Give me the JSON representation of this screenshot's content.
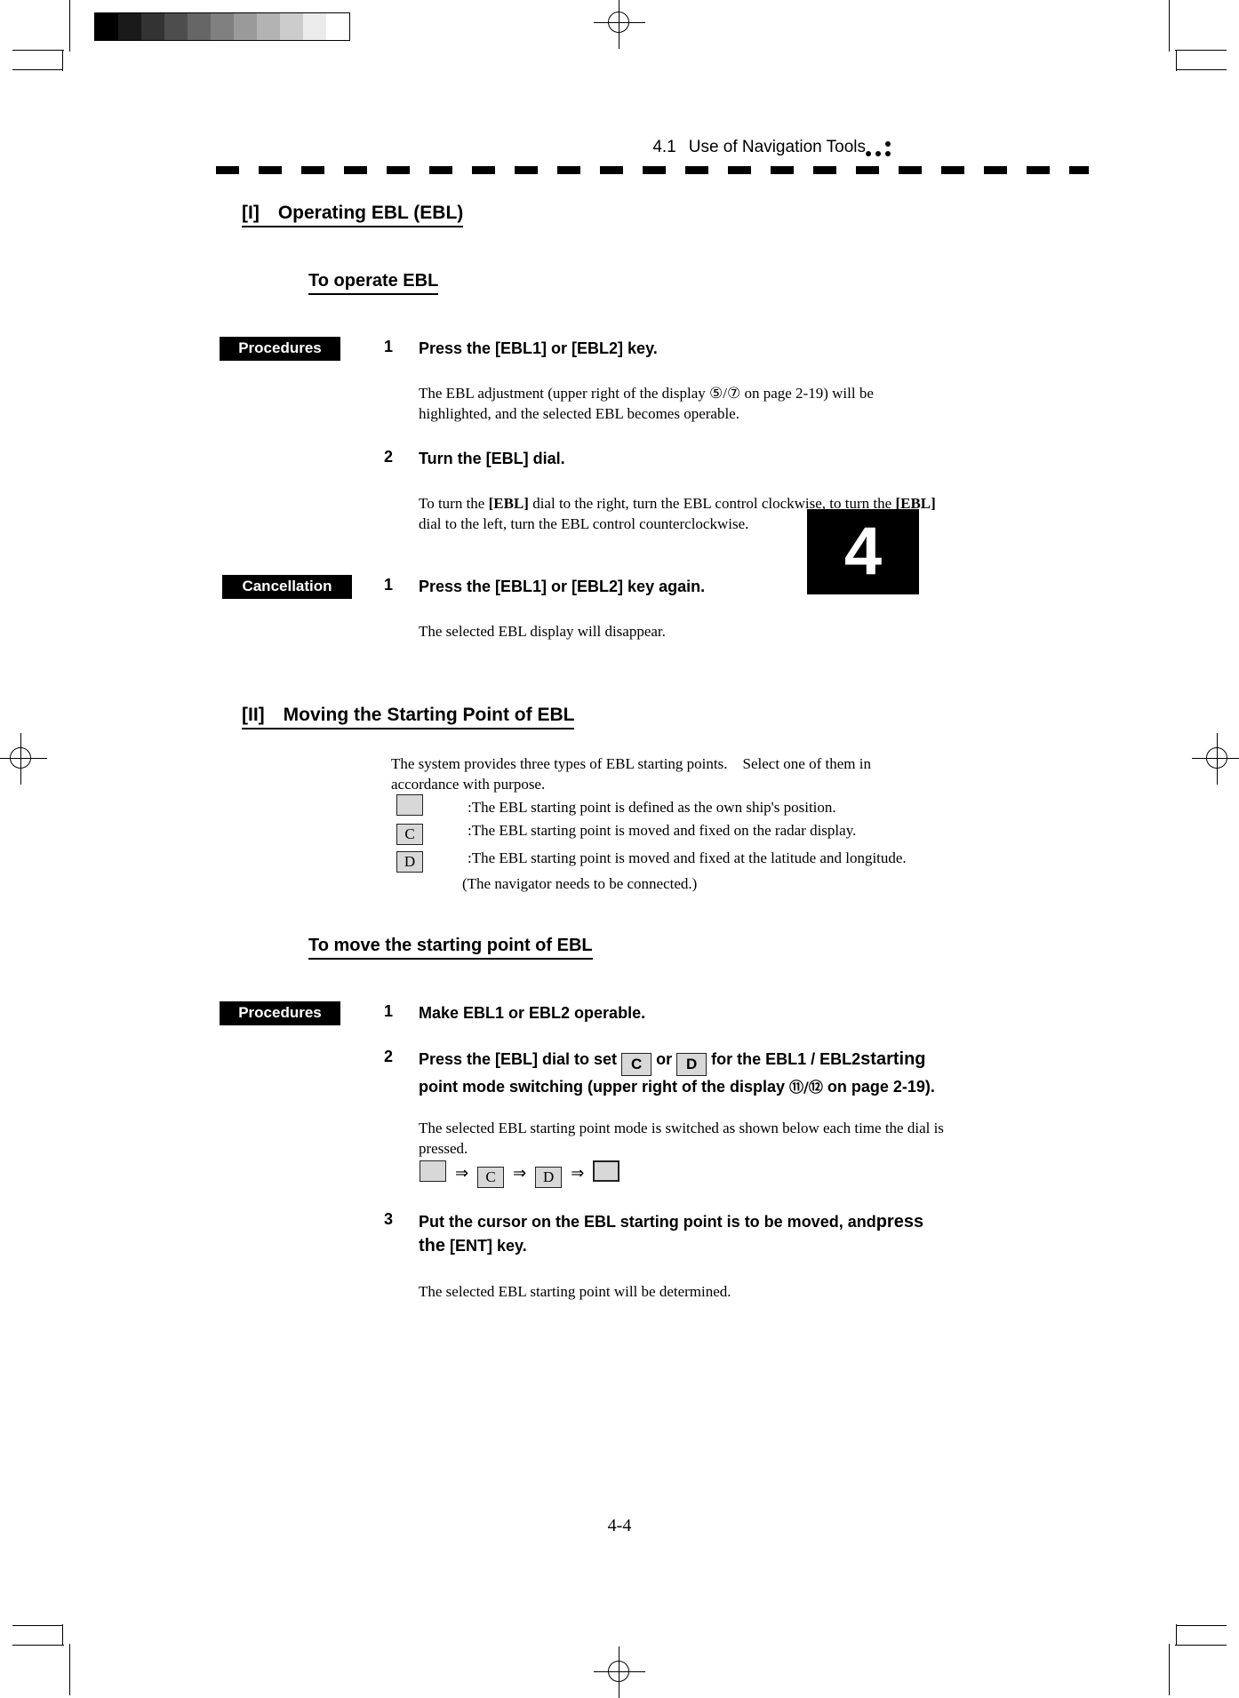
{
  "header": {
    "section_number": "4.1",
    "section_title": "Use of Navigation Tools"
  },
  "chapter_tab": "4",
  "footer": {
    "page_number": "4-4"
  },
  "sections": [
    {
      "heading": "[I] Operating EBL (EBL)",
      "subheading": "To operate EBL",
      "blocks": [
        {
          "tag": "Procedures",
          "steps": [
            {
              "number": "1",
              "title": "Press the [EBL1] or [EBL2] key.",
              "body_lines": [
                "The EBL adjustment (upper right of the display  ⑤/⑦  on page 2-19) will be",
                "highlighted, and the selected EBL becomes operable."
              ]
            },
            {
              "number": "2",
              "title": "Turn the [EBL] dial.",
              "body_lines": [
                "To turn the [EBL] dial to the right, turn the EBL control clockwise, to turn the [EBL]",
                "dial to the left, turn the EBL control counterclockwise."
              ]
            }
          ]
        },
        {
          "tag": "Cancellation",
          "steps": [
            {
              "number": "1",
              "title": "Press the [EBL1] or [EBL2] key again.",
              "body_lines": [
                "The selected EBL display will disappear."
              ]
            }
          ]
        }
      ]
    },
    {
      "heading": "[II] Moving the Starting Point of EBL",
      "subheading": "To move the starting point of EBL",
      "intro_lines": [
        "The system provides three types of EBL starting points. Select one of them in",
        "accordance with purpose."
      ],
      "legend": [
        {
          "key": "",
          "text": ":The EBL starting point is defined as the own ship's position."
        },
        {
          "key": "C",
          "text": ":The EBL starting point is moved and fixed on the radar display."
        },
        {
          "key": "D",
          "text": ":The EBL starting point is moved and fixed at the latitude and longitude."
        }
      ],
      "legend_note": "(The navigator needs to be connected.)",
      "blocks": [
        {
          "tag": "Procedures",
          "steps": [
            {
              "number": "1",
              "title": "Make EBL1 or EBL2 operable.",
              "body_lines": []
            },
            {
              "number": "2",
              "title_part1": "Press the [EBL] dial to set",
              "key_c": "C",
              "title_or": "or",
              "key_d": "D",
              "title_part2": "for the EBL1 / EBL2",
              "title_part3": "starting",
              "title_line2_a": "point mode switching (upper right of the display",
              "title_line2_circ": "⑪/⑫",
              "title_line2_b": "on page 2-19).",
              "body_lines": [
                "The selected EBL starting point mode is switched as shown below each time the dial is",
                "pressed."
              ],
              "sequence": [
                "",
                "C",
                "D",
                ""
              ],
              "sequence_arrow": "⇒"
            },
            {
              "number": "3",
              "title_a": "Put the cursor on the EBL starting point is to be moved, and",
              "title_b": "press",
              "title_c": "the",
              "title_d": "[ENT] key.",
              "body_lines": [
                "The selected EBL starting point will be determined."
              ]
            }
          ]
        }
      ]
    }
  ],
  "calibration": {
    "swatches": [
      "#000000",
      "#1a1a1a",
      "#333333",
      "#4d4d4d",
      "#666666",
      "#808080",
      "#9a9a9a",
      "#b3b3b3",
      "#cccccc",
      "#ebebeb",
      "#ffffff"
    ]
  },
  "colors": {
    "ink": "#000000",
    "key_fill": "#d8d8d8",
    "paper": "#ffffff"
  }
}
